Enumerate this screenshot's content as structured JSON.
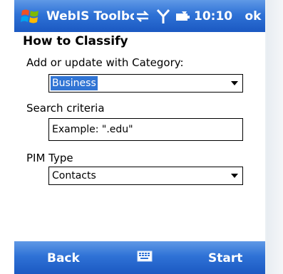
{
  "titlebar": {
    "title": "WebIS Toolbo",
    "time": "10:10",
    "ok_label": "ok",
    "icons": [
      "windows-start-icon",
      "connectivity-icon",
      "signal-icon",
      "battery-icon"
    ]
  },
  "form": {
    "heading": "How to Classify",
    "category": {
      "label": "Add or update with Category:",
      "value": "Business"
    },
    "search": {
      "label": "Search criteria",
      "value": "Example: \".edu\""
    },
    "pim": {
      "label": "PIM Type",
      "value": "Contacts"
    }
  },
  "softkeys": {
    "left": "Back",
    "right": "Start",
    "keyboard_icon": "keyboard-icon"
  },
  "colors": {
    "bar_top": "#5f99e6",
    "bar_bottom": "#1b59c2",
    "selection": "#3074d4"
  }
}
